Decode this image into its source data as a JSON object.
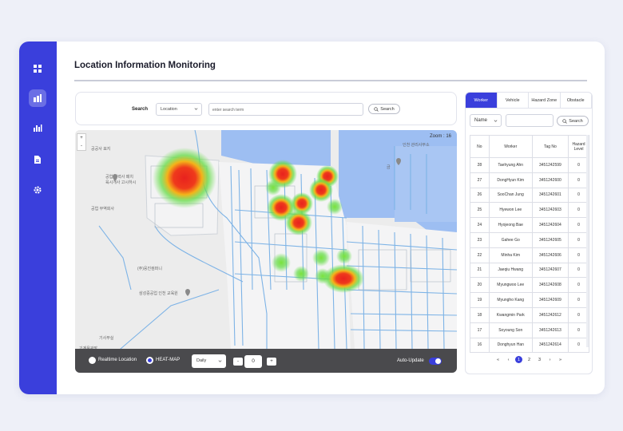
{
  "page": {
    "title": "Location Information Monitoring"
  },
  "sidebar": {
    "icons": [
      "dashboard-icon",
      "building-chart-icon",
      "bar-chart-icon",
      "document-icon",
      "gear-icon"
    ],
    "active_index": 1
  },
  "search": {
    "label": "Search",
    "field_value": "Location",
    "placeholder": "enter search term",
    "button_label": "Search"
  },
  "map": {
    "zoom_label": "Zoom : 16",
    "zoom_in": "+",
    "zoom_out": "-",
    "options": {
      "realtime_label": "Realtime Location",
      "heatmap_label": "HEAT-MAP",
      "selected": "HEAT-MAP"
    },
    "period": "Daily",
    "stepper": {
      "minus": "-",
      "value": "0",
      "plus": "+"
    },
    "auto_update_label": "Auto-Update",
    "auto_update_on": true,
    "place_labels": [
      "공업 협력사 패치",
      "육시개사 고시하시",
      "공업 무역회사",
      "금",
      "인천 관리사무소",
      "(주)웅진컴퍼니",
      "삼성중공업 인천 교육원",
      "공공사 표지",
      "기사무실",
      "기계용광장"
    ],
    "colors": {
      "water": "#9dbef2",
      "road": "#7db3e6",
      "heat_core": "#e8221e",
      "heat_mid": "#f4b41a",
      "heat_outer": "#64dc46"
    }
  },
  "panel": {
    "tabs": [
      "Worker",
      "Vehicle",
      "Hazard Zone",
      "Obstacle"
    ],
    "active_tab": "Worker",
    "filter_value": "Name",
    "filter_button": "Search",
    "columns": [
      "No",
      "Worker",
      "Tag No",
      "Hazard Level"
    ],
    "rows": [
      [
        "28",
        "Taehyung Ahn",
        "3451242599",
        "0"
      ],
      [
        "27",
        "DongHyun Kim",
        "3451242600",
        "0"
      ],
      [
        "26",
        "SooChan Jung",
        "3451242601",
        "0"
      ],
      [
        "25",
        "Hyewon Lee",
        "3451242603",
        "0"
      ],
      [
        "24",
        "Hyojeong Bae",
        "3451242604",
        "0"
      ],
      [
        "23",
        "Gahee Go",
        "3451242605",
        "0"
      ],
      [
        "22",
        "Minha Kim",
        "3451242606",
        "0"
      ],
      [
        "21",
        "Jaeqiu Hwang",
        "3451242607",
        "0"
      ],
      [
        "20",
        "Myungwoo Lee",
        "3451242608",
        "0"
      ],
      [
        "19",
        "Myungho Kang",
        "3451242609",
        "0"
      ],
      [
        "18",
        "Kwangmin Park",
        "3451242612",
        "0"
      ],
      [
        "17",
        "Soyoung Son",
        "3451242613",
        "0"
      ],
      [
        "16",
        "Donghyun Han",
        "3451242614",
        "0"
      ]
    ],
    "pagination": {
      "first": "«",
      "prev": "‹",
      "pages": [
        "1",
        "2",
        "3"
      ],
      "current": "1",
      "next": "›",
      "last": "»"
    }
  }
}
